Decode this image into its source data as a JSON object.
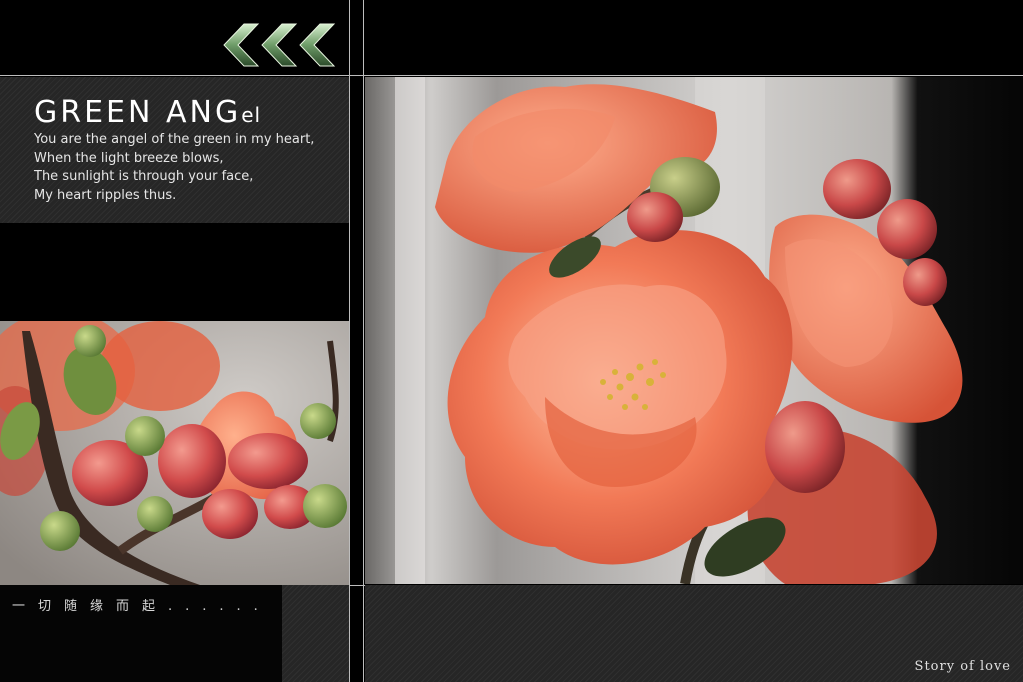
{
  "header": {
    "title_main": "GREEN ANG",
    "title_suffix": "el",
    "chevron_icon": "triple-chevron-left-icon"
  },
  "poem": {
    "lines": [
      "You are the angel of the green in my heart,",
      "When the light breeze blows,",
      "The sunlight is through your face,",
      "My heart ripples thus."
    ]
  },
  "captions": {
    "chinese": "一切随缘而起......",
    "story": "Story of love"
  },
  "colors": {
    "background": "#000000",
    "panel": "#262626",
    "divider": "#bdbdbd",
    "flower": "#e8603f",
    "bud": "#c84a4a",
    "stamen": "#d8b23a",
    "chevron": "#9fc79a"
  },
  "images": {
    "left_photo": "quince-buds-photo",
    "right_photo": "quince-blossom-photo"
  }
}
